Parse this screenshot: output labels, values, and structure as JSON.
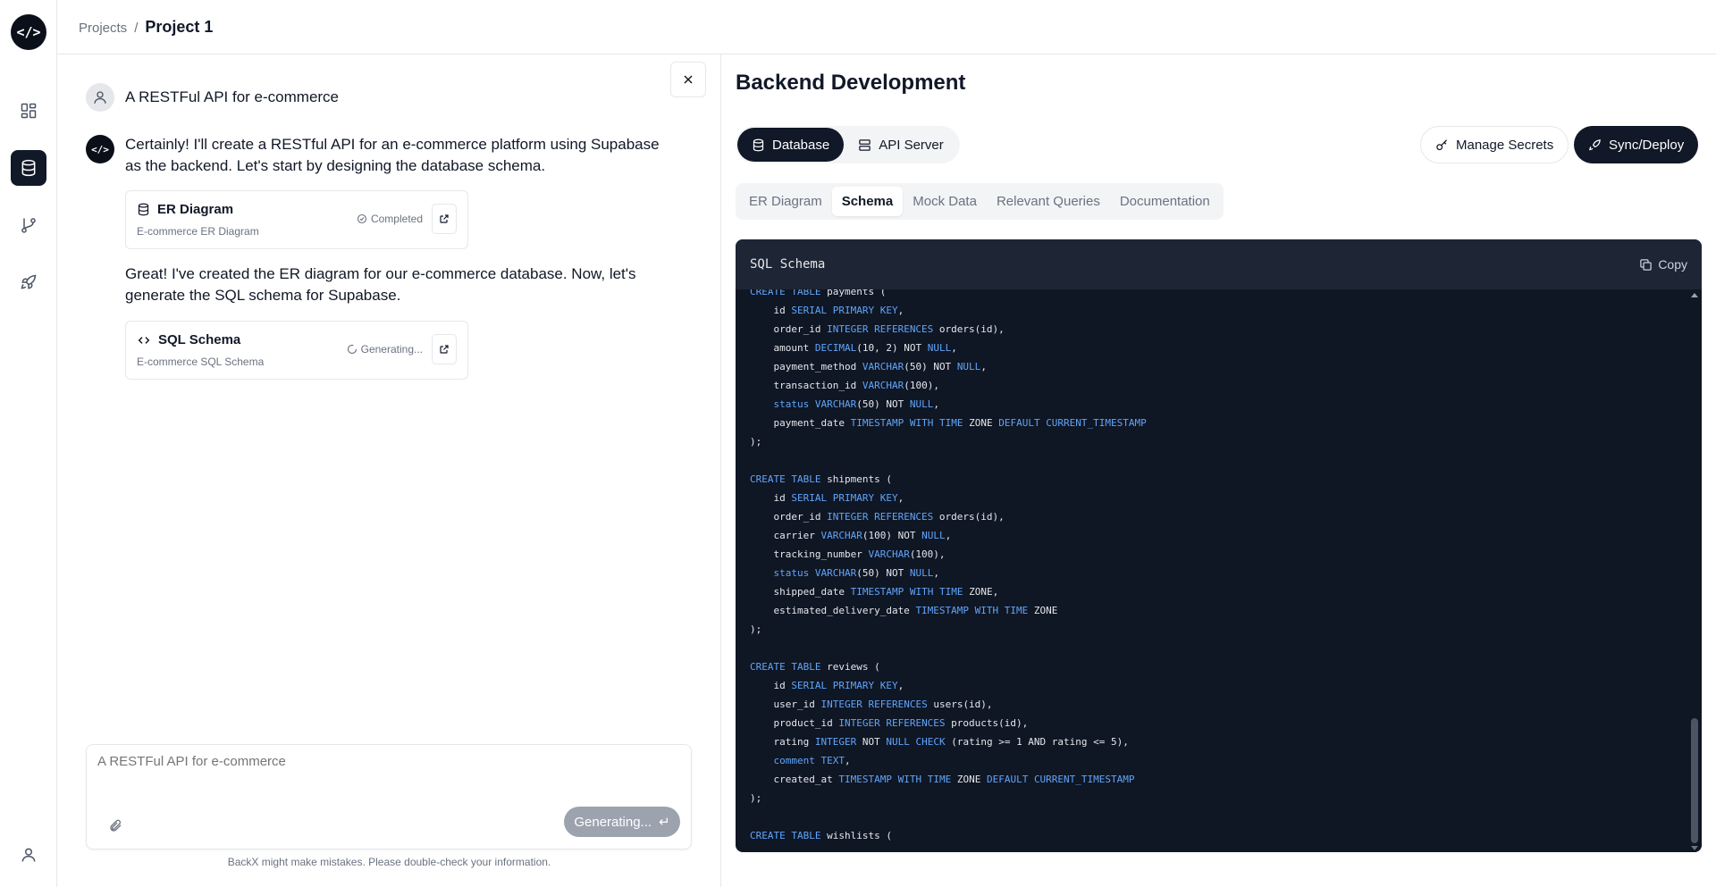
{
  "rail": {
    "logo_text": "</>",
    "items": [
      {
        "name": "dashboard-icon",
        "active": false
      },
      {
        "name": "database-icon",
        "active": true
      },
      {
        "name": "git-branch-icon",
        "active": false
      },
      {
        "name": "rocket-icon",
        "active": false
      }
    ],
    "bottom_icon": "user-icon"
  },
  "header": {
    "breadcrumb_parent": "Projects",
    "breadcrumb_sep": "/",
    "breadcrumb_current": "Project 1"
  },
  "chat": {
    "user_message": "A RESTFul API for e-commerce",
    "bot_logo": "</>",
    "bot_message_1": "Certainly! I'll create a RESTful API for an e-commerce platform using Supabase as the backend. Let's start by designing the database schema.",
    "card_1": {
      "title": "ER Diagram",
      "subtitle": "E-commerce ER Diagram",
      "status": "Completed"
    },
    "bot_message_2": "Great! I've created the ER diagram for our e-commerce database. Now, let's generate the SQL schema for Supabase.",
    "card_2": {
      "title": "SQL Schema",
      "subtitle": "E-commerce SQL Schema",
      "status": "Generating..."
    },
    "composer_placeholder": "A RESTFul API for e-commerce",
    "generate_label": "Generating...",
    "generate_symbol": "↵",
    "disclaimer": "BackX might make mistakes. Please double-check your information."
  },
  "panel": {
    "title": "Backend Development",
    "seg_database": "Database",
    "seg_api": "API Server",
    "manage_secrets": "Manage Secrets",
    "sync_deploy": "Sync/Deploy",
    "tabs": [
      "ER Diagram",
      "Schema",
      "Mock Data",
      "Relevant Queries",
      "Documentation"
    ],
    "active_tab": "Schema",
    "code_title": "SQL Schema",
    "copy_label": "Copy"
  },
  "code_lines": [
    "CREATE TABLE payments (",
    "    id SERIAL PRIMARY KEY,",
    "    order_id INTEGER REFERENCES orders(id),",
    "    amount DECIMAL(10, 2) NOT NULL,",
    "    payment_method VARCHAR(50) NOT NULL,",
    "    transaction_id VARCHAR(100),",
    "    status VARCHAR(50) NOT NULL,",
    "    payment_date TIMESTAMP WITH TIME ZONE DEFAULT CURRENT_TIMESTAMP",
    ");",
    "",
    "CREATE TABLE shipments (",
    "    id SERIAL PRIMARY KEY,",
    "    order_id INTEGER REFERENCES orders(id),",
    "    carrier VARCHAR(100) NOT NULL,",
    "    tracking_number VARCHAR(100),",
    "    status VARCHAR(50) NOT NULL,",
    "    shipped_date TIMESTAMP WITH TIME ZONE,",
    "    estimated_delivery_date TIMESTAMP WITH TIME ZONE",
    ");",
    "",
    "CREATE TABLE reviews (",
    "    id SERIAL PRIMARY KEY,",
    "    user_id INTEGER REFERENCES users(id),",
    "    product_id INTEGER REFERENCES products(id),",
    "    rating INTEGER NOT NULL CHECK (rating >= 1 AND rating <= 5),",
    "    comment TEXT,",
    "    created_at TIMESTAMP WITH TIME ZONE DEFAULT CURRENT_TIMESTAMP",
    ");",
    "",
    "CREATE TABLE wishlists ("
  ],
  "colors": {
    "accent_dark": "#111827",
    "code_bg": "#0f1624",
    "code_keyword": "#60a5fa"
  }
}
